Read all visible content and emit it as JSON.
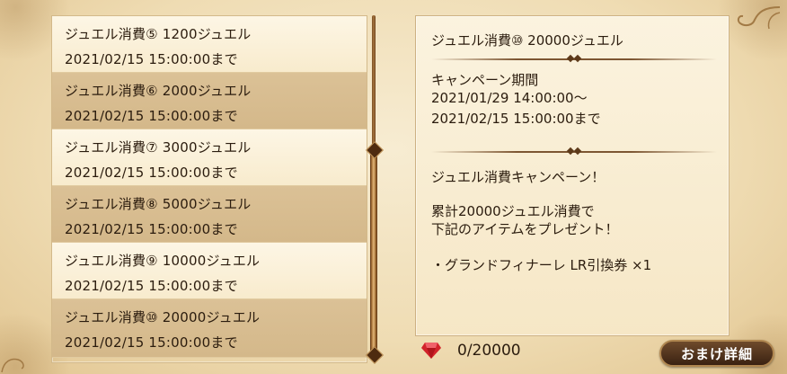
{
  "campaign_list": [
    {
      "name": "ジュエル消費⑤ 1200ジュエル",
      "date": "2021/02/15 15:00:00まで"
    },
    {
      "name": "ジュエル消費⑥ 2000ジュエル",
      "date": "2021/02/15 15:00:00まで"
    },
    {
      "name": "ジュエル消費⑦ 3000ジュエル",
      "date": "2021/02/15 15:00:00まで"
    },
    {
      "name": "ジュエル消費⑧ 5000ジュエル",
      "date": "2021/02/15 15:00:00まで"
    },
    {
      "name": "ジュエル消費⑨ 10000ジュエル",
      "date": "2021/02/15 15:00:00まで"
    },
    {
      "name": "ジュエル消費⑩ 20000ジュエル",
      "date": "2021/02/15 15:00:00まで"
    }
  ],
  "detail": {
    "title": "ジュエル消費⑩ 20000ジュエル",
    "period_label": "キャンペーン期間",
    "period_start": "2021/01/29 14:00:00～",
    "period_end": "2021/02/15 15:00:00まで",
    "heading": "ジュエル消費キャンペーン！",
    "desc_line1": "累計20000ジュエル消費で",
    "desc_line2": "下記のアイテムをプレゼント！",
    "reward": "・グランドフィナーレ LR引換券 ×1"
  },
  "progress": {
    "text": "0/20000",
    "icon": "jewel-icon",
    "icon_color": "#d2232a"
  },
  "buttons": {
    "omake_label": "おまけ詳細"
  }
}
